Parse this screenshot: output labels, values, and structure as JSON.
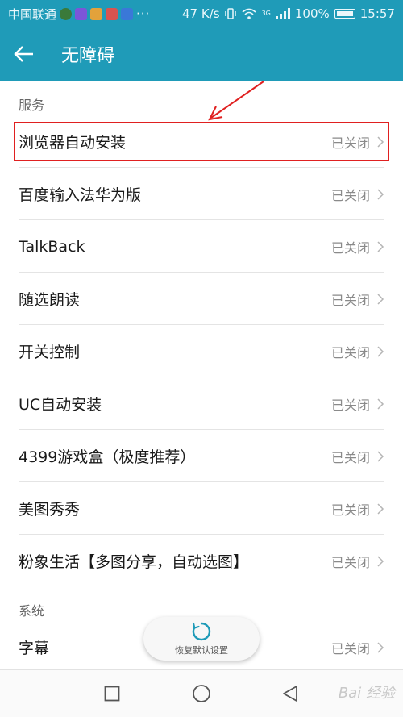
{
  "status_bar": {
    "carrier": "中国联通",
    "net_speed": "47 K/s",
    "signal_label": "3G",
    "battery": "100%",
    "time": "15:57",
    "more": "···"
  },
  "header": {
    "title": "无障碍"
  },
  "sections": [
    {
      "title": "服务",
      "items": [
        {
          "label": "浏览器自动安装",
          "status": "已关闭"
        },
        {
          "label": "百度输入法华为版",
          "status": "已关闭"
        },
        {
          "label": "TalkBack",
          "status": "已关闭"
        },
        {
          "label": "随选朗读",
          "status": "已关闭"
        },
        {
          "label": "开关控制",
          "status": "已关闭"
        },
        {
          "label": "UC自动安装",
          "status": "已关闭"
        },
        {
          "label": "4399游戏盒（极度推荐）",
          "status": "已关闭"
        },
        {
          "label": "美图秀秀",
          "status": "已关闭"
        },
        {
          "label": "粉象生活【多图分享，自动选图】",
          "status": "已关闭"
        }
      ]
    },
    {
      "title": "系统",
      "items": [
        {
          "label": "字幕",
          "status": "已关闭"
        }
      ]
    }
  ],
  "restore_button": {
    "label": "恢复默认设置"
  },
  "watermark": "Bai 经验",
  "colors": {
    "accent": "#1f9bb8",
    "highlight": "#e02020"
  }
}
